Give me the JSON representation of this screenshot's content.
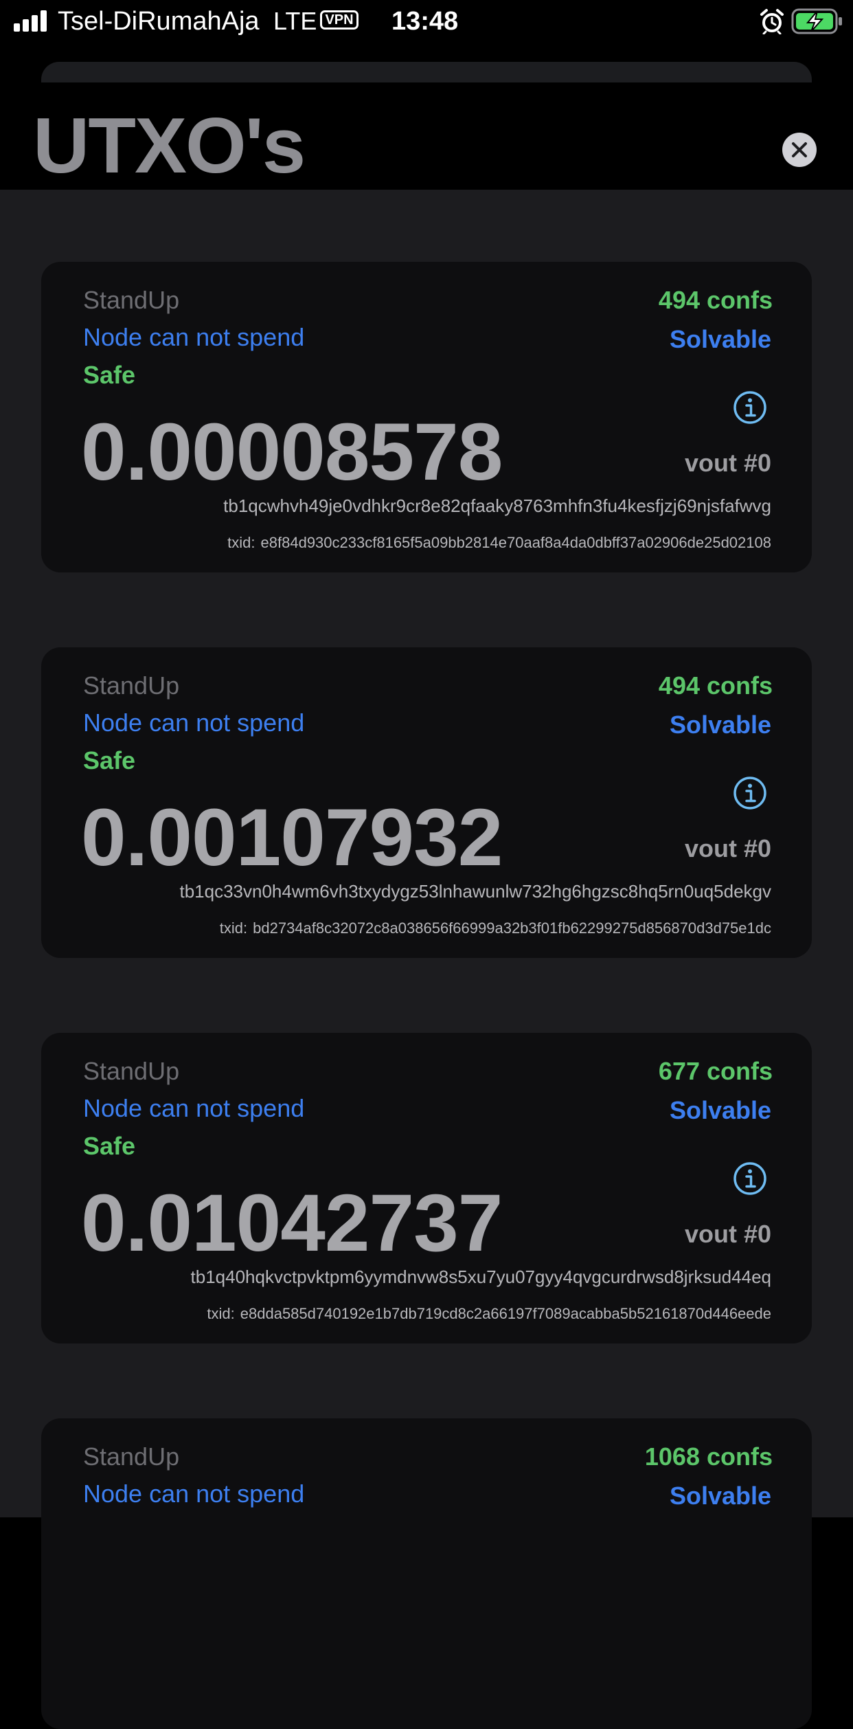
{
  "status_bar": {
    "carrier": "Tsel-DiRumahAja",
    "network": "LTE",
    "vpn": "VPN",
    "time": "13:48",
    "signal_bars": 4,
    "icons": [
      "signal-icon",
      "alarm-icon",
      "battery-charging-icon"
    ]
  },
  "header": {
    "title": "UTXO's",
    "close_icon": "close-icon"
  },
  "txid_prefix": "txid:",
  "utxos": [
    {
      "wallet": "StandUp",
      "spend_status": "Node can not spend",
      "safe_status": "Safe",
      "confs": "494 confs",
      "solvable": "Solvable",
      "amount": "0.00008578",
      "vout": "vout #0",
      "address": "tb1qcwhvh49je0vdhkr9cr8e82qfaaky8763mhfn3fu4kesfjzj69njsfafwvg",
      "txid": "e8f84d930c233cf8165f5a09bb2814e70aaf8a4da0dbff37a02906de25d02108"
    },
    {
      "wallet": "StandUp",
      "spend_status": "Node can not spend",
      "safe_status": "Safe",
      "confs": "494 confs",
      "solvable": "Solvable",
      "amount": "0.00107932",
      "vout": "vout #0",
      "address": "tb1qc33vn0h4wm6vh3txydygz53lnhawunlw732hg6hgzsc8hq5rn0uq5dekgv",
      "txid": "bd2734af8c32072c8a038656f66999a32b3f01fb62299275d856870d3d75e1dc"
    },
    {
      "wallet": "StandUp",
      "spend_status": "Node can not spend",
      "safe_status": "Safe",
      "confs": "677 confs",
      "solvable": "Solvable",
      "amount": "0.01042737",
      "vout": "vout #0",
      "address": "tb1q40hqkvctpvktpm6yymdnvw8s5xu7yu07gyy4qvgcurdrwsd8jrksud44eq",
      "txid": "e8dda585d740192e1b7db719cd8c2a66197f7089acabba5b52161870d446eede"
    },
    {
      "wallet": "StandUp",
      "spend_status": "Node can not spend",
      "confs": "1068 confs",
      "solvable": "Solvable"
    }
  ],
  "colors": {
    "background": "#000000",
    "list_background": "#1c1c1f",
    "card_background": "#0e0e10",
    "confs_green": "#5cc66a",
    "safe_green": "#5cc66a",
    "link_blue": "#3d7ff0",
    "info_blue": "#6fbcf2",
    "amount_gray": "#a6a6aa",
    "title_gray": "#8e8e93"
  }
}
